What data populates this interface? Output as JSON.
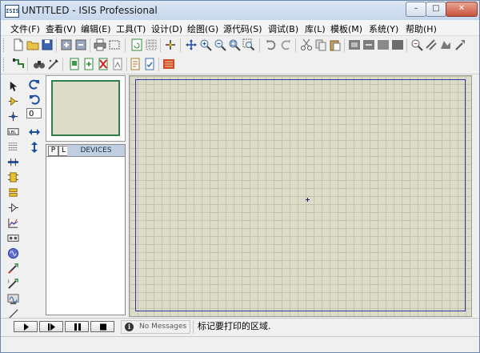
{
  "window": {
    "app_icon_text": "ISIS",
    "title": "UNTITLED - ISIS Professional",
    "minimize_glyph": "–",
    "maximize_glyph": "□",
    "close_glyph": "✕"
  },
  "menu": [
    {
      "label": "文件(F)"
    },
    {
      "label": "查看(V)"
    },
    {
      "label": "编辑(E)"
    },
    {
      "label": "工具(T)"
    },
    {
      "label": "设计(D)"
    },
    {
      "label": "绘图(G)"
    },
    {
      "label": "源代码(S)"
    },
    {
      "label": "调试(B)"
    },
    {
      "label": "库(L)"
    },
    {
      "label": "模板(M)"
    },
    {
      "label": "系统(Y)"
    },
    {
      "label": "帮助(H)"
    }
  ],
  "rotation": {
    "angle": "0"
  },
  "device_panel": {
    "p_label": "P",
    "l_label": "L",
    "title": "DEVICES"
  },
  "status": {
    "message_icon": "i",
    "messages": "No Messages",
    "text": "标记要打印的区域."
  },
  "colors": {
    "canvas": "#dcdcc8",
    "grid": "#c3c3ad",
    "sheet_border": "#3333aa",
    "overview_border": "#2e7d4a",
    "devices_header": "#bfcfe0"
  }
}
